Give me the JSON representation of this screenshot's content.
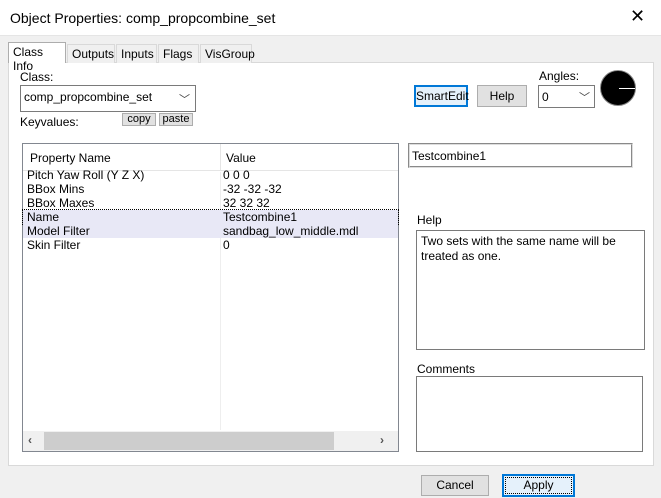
{
  "window": {
    "title": "Object Properties: comp_propcombine_set",
    "close_icon": "✕"
  },
  "tabs": [
    "Class Info",
    "Outputs",
    "Inputs",
    "Flags",
    "VisGroup"
  ],
  "class_label": "Class:",
  "class_value": "comp_propcombine_set",
  "keyvalues_label": "Keyvalues:",
  "copy_label": "copy",
  "paste_label": "paste",
  "smartedit_label": "SmartEdit",
  "help_button_label": "Help",
  "angles_label": "Angles:",
  "angles_value": "0",
  "table": {
    "headers": [
      "Property Name",
      "Value"
    ],
    "rows": [
      {
        "name": "Pitch Yaw Roll (Y Z X)",
        "value": "0 0 0"
      },
      {
        "name": "BBox Mins",
        "value": "-32 -32 -32"
      },
      {
        "name": "BBox Maxes",
        "value": "32 32 32"
      },
      {
        "name": "Name",
        "value": "Testcombine1"
      },
      {
        "name": "Model Filter",
        "value": "sandbag_low_middle.mdl"
      },
      {
        "name": "Skin Filter",
        "value": "0"
      }
    ]
  },
  "value_edit": "Testcombine1",
  "help_label": "Help",
  "help_text": "Two sets with the same name will be treated as one.",
  "comments_label": "Comments",
  "comments_text": "",
  "cancel_label": "Cancel",
  "apply_label": "Apply"
}
